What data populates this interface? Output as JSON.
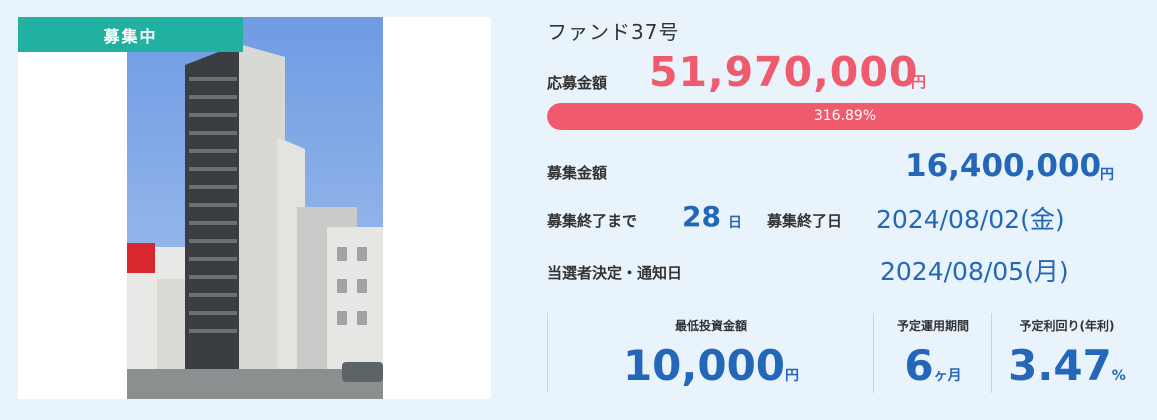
{
  "card": {
    "badge": "募集中",
    "photo_alt": "high-rise apartment building"
  },
  "fund": {
    "title": "ファンド37号",
    "applied_label": "応募金額",
    "applied_value": "51,970,000",
    "applied_unit": "円",
    "progress_text": "316.89%",
    "progress_percent": 316.89,
    "target_label": "募集金額",
    "target_value": "16,400,000",
    "target_unit": "円",
    "remaining_label": "募集終了まで",
    "remaining_value": "28",
    "remaining_unit": "日",
    "end_label": "募集終了日",
    "end_value": "2024/08/02(金)",
    "notify_label": "当選者決定・通知日",
    "notify_value": "2024/08/05(月)"
  },
  "stats": {
    "min_label": "最低投資金額",
    "min_value": "10,000",
    "min_unit": "円",
    "period_label": "予定運用期間",
    "period_value": "6",
    "period_unit": "ヶ月",
    "yield_label": "予定利回り(年利)",
    "yield_value": "3.47",
    "yield_unit": "%"
  },
  "colors": {
    "accent_red": "#ef5a6c",
    "accent_blue": "#2467b8",
    "badge_teal": "#22b0a0",
    "background": "#e8f3fb"
  }
}
